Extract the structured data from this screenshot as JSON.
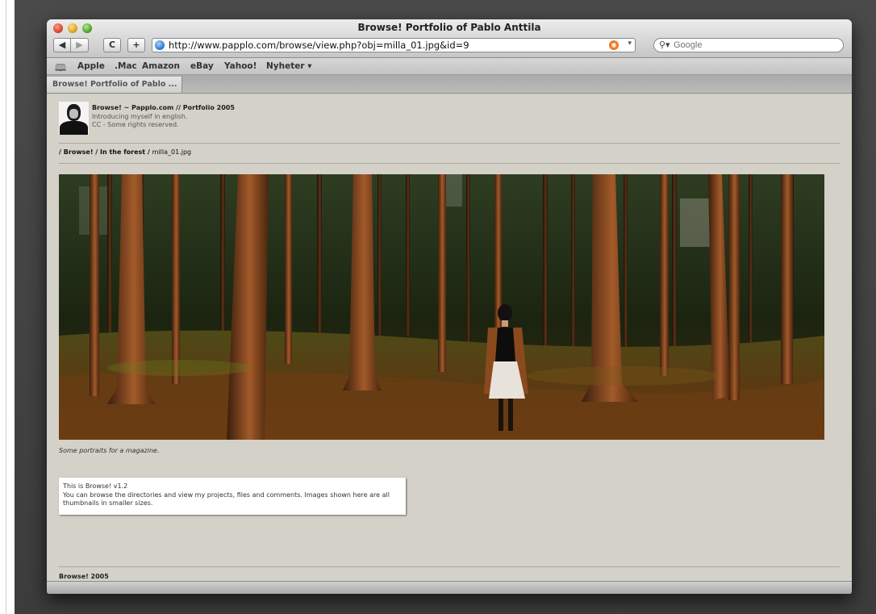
{
  "browser": {
    "window_title": "Browse! Portfolio of Pablo Anttila",
    "back_label": "◀",
    "forward_label": "▶",
    "reload_label": "C",
    "add_label": "+",
    "address_url": "http://www.papplo.com/browse/view.php?obj=milla_01.jpg&id=9",
    "search_placeholder": "Google",
    "tab_label": "Browse! Portfolio of Pablo ...",
    "bookmarks": [
      "Apple",
      ".Mac",
      "Amazon",
      "eBay",
      "Yahoo!",
      "Nyheter ▾"
    ]
  },
  "page": {
    "site_name": "Browse! ~ Papplo.com // Portfolio 2005",
    "tagline": "Introducing myself in english.",
    "license": "CC - Some rights reserved.",
    "breadcrumb": {
      "sep": "/",
      "root": "Browse!",
      "folder": "In the forest",
      "file": "milla_01.jpg"
    },
    "photo_caption": "Some portraits for a magazine.",
    "info": {
      "title": "This is Browse! v1.2",
      "text": "You can browse the directories and view my projects, files and comments. Images shown here are all thumbnails in smaller sizes."
    },
    "footer": "Browse! 2005"
  }
}
